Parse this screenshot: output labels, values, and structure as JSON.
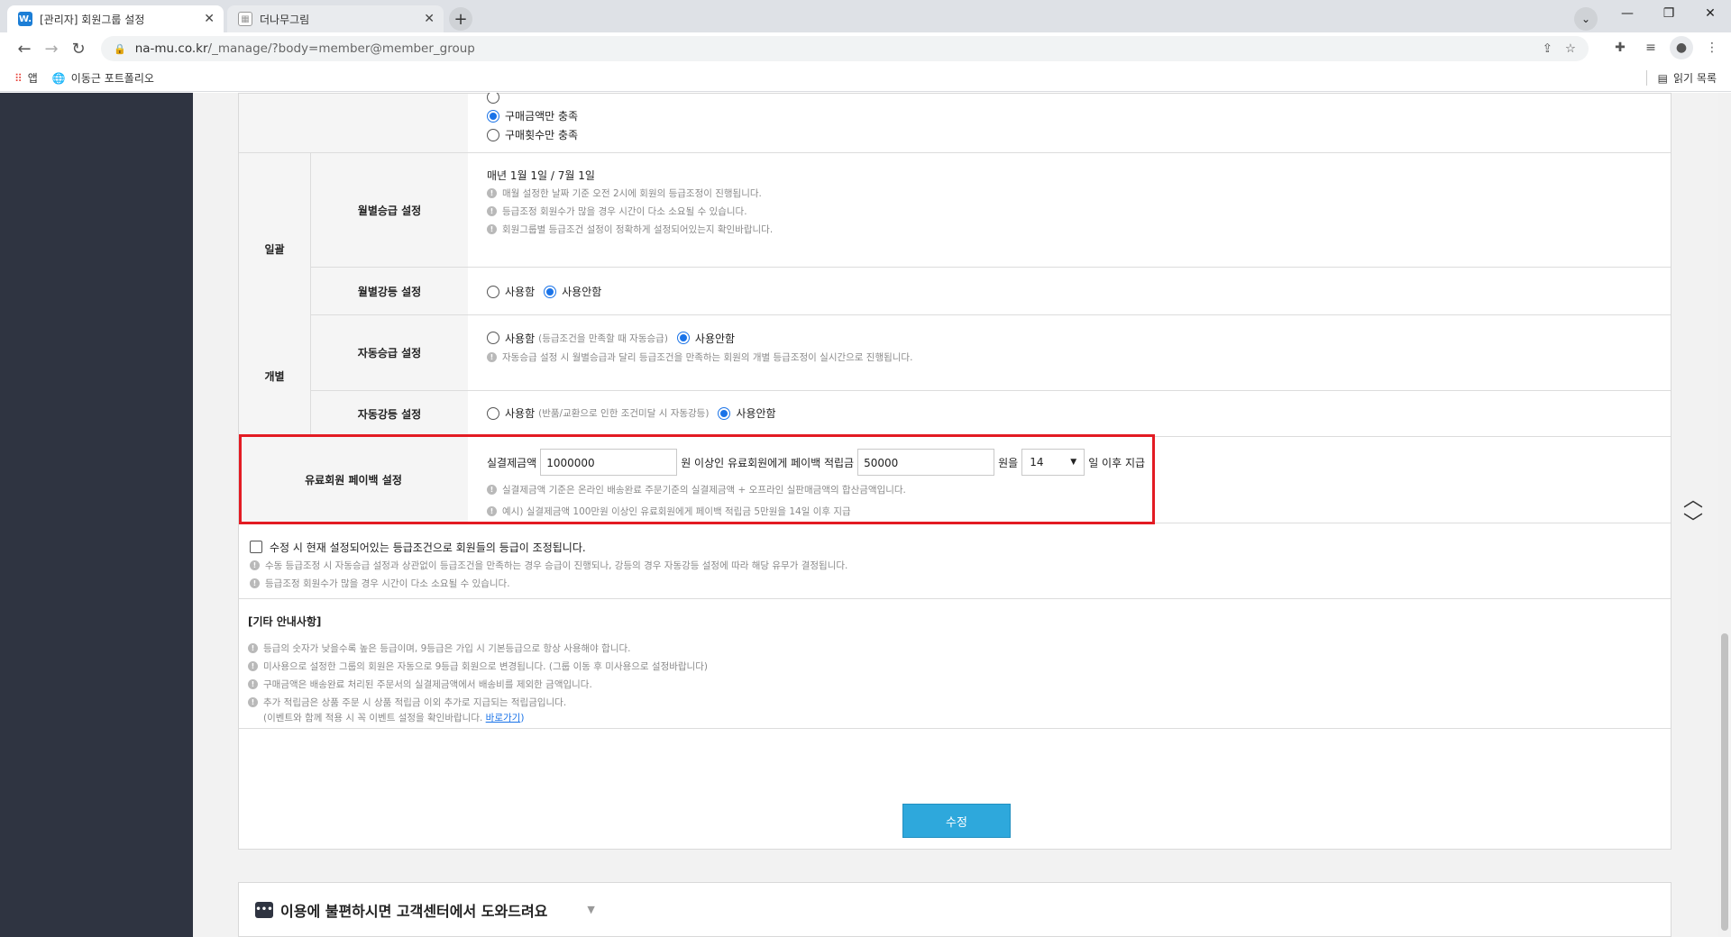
{
  "browser": {
    "tabs": [
      {
        "title": "[관리자] 회원그룹 설정",
        "favicon": "W",
        "active": true
      },
      {
        "title": "더나무그림",
        "favicon": "grid",
        "active": false
      }
    ],
    "url_host": "na-mu.co.kr",
    "url_path": "/_manage/?body=member@member_group",
    "bookmarks": [
      {
        "label": "앱",
        "icon": "apps-grid-icon"
      },
      {
        "label": "이동근 포트폴리오",
        "icon": "globe-icon"
      }
    ],
    "reading_list": "읽기 목록"
  },
  "top_options": {
    "radio1": "구매금액만 충족",
    "radio2": "구매횟수만 충족"
  },
  "batch": {
    "label": "일괄",
    "monthly_up": {
      "label": "월별승급 설정",
      "schedule": "매년 1월 1일 / 7월 1일",
      "notes": [
        "매월 설정한 날짜 기준 오전 2시에 회원의 등급조정이 진행됩니다.",
        "등급조정 회원수가 많을 경우 시간이 다소 소요될 수 있습니다.",
        "회원그룹별 등급조건 설정이 정확하게 설정되어있는지 확인바랍니다."
      ]
    },
    "monthly_down": {
      "label": "월별강등 설정",
      "opt_use": "사용함",
      "opt_nouse": "사용안함"
    }
  },
  "individual": {
    "label": "개별",
    "auto_up": {
      "label": "자동승급 설정",
      "opt_use": "사용함",
      "opt_use_hint": "(등급조건을 만족할 때 자동승급)",
      "opt_nouse": "사용안함",
      "note": "자동승급 설정 시 월별승급과 달리 등급조건을 만족하는 회원의 개별 등급조정이 실시간으로 진행됩니다."
    },
    "auto_down": {
      "label": "자동강등 설정",
      "opt_use": "사용함",
      "opt_use_hint": "(반품/교환으로 인한 조건미달 시 자동강등)",
      "opt_nouse": "사용안함"
    }
  },
  "payback": {
    "label": "유료회원 페이백 설정",
    "prefix": "실결제금액",
    "amount": "1000000",
    "mid": "원 이상인 유료회원에게 페이백 적립금",
    "reward": "50000",
    "unit": "원을",
    "days": "14",
    "suffix": "일 이후 지급",
    "notes": [
      "실결제금액 기준은 온라인 배송완료 주문기준의 실결제금액 + 오프라인 실판매금액의 합산금액입니다.",
      "예시) 실결제금액 100만원 이상인 유료회원에게 페이백 적립금 5만원을 14일 이후 지급"
    ]
  },
  "confirm": {
    "checkbox": "수정 시 현재 설정되어있는 등급조건으로 회원들의 등급이 조정됩니다.",
    "notes": [
      "수동 등급조정 시 자동승급 설정과 상관없이 등급조건을 만족하는 경우 승급이 진행되나, 강등의 경우 자동강등 설정에 따라 해당 유무가 결정됩니다.",
      "등급조정 회원수가 많을 경우 시간이 다소 소요될 수 있습니다."
    ]
  },
  "etc": {
    "title": "[기타 안내사항]",
    "notes": [
      "등급의 숫자가 낮을수록 높은 등급이며, 9등급은 가입 시 기본등급으로 항상 사용해야 합니다.",
      "미사용으로 설정한 그룹의 회원은 자동으로 9등급 회원으로 변경됩니다. (그룹 이동 후 미사용으로 설정바랍니다)",
      "구매금액은 배송완료 처리된 주문서의 실결제금액에서 배송비를 제외한 금액입니다.",
      "추가 적립금은 상품 주문 시 상품 적립금 이외 추가로 지급되는 적립금입니다."
    ],
    "last_sub": "(이벤트와 함께 적용 시 꼭 이벤트 설정을 확인바랍니다.",
    "link": "바로가기",
    "link_close": ")"
  },
  "submit_label": "수정",
  "help_text": "이용에 불편하시면 고객센터에서 도와드려요",
  "colors": {
    "accent": "#2ea8dc",
    "highlight": "#e31b23",
    "sidebar": "#2f3441"
  }
}
